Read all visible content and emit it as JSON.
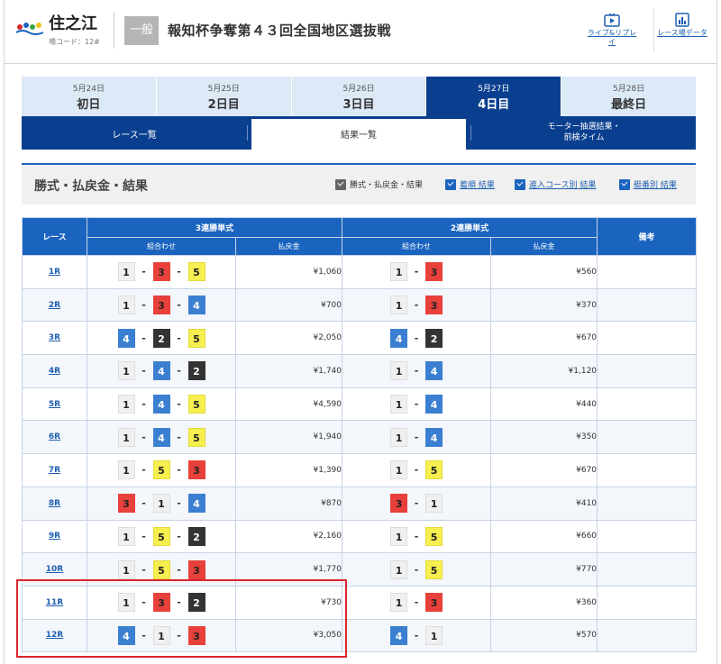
{
  "header": {
    "venue": "住之江",
    "venue_code": "場コード：12#",
    "grade": "一般",
    "race_title": "報知杯争奪第４３回全国地区選抜戦",
    "live_label": "ライブ&リプレイ",
    "data_label": "レース場データ"
  },
  "days": [
    {
      "date": "5月24日",
      "name": "初日",
      "active": false
    },
    {
      "date": "5月25日",
      "name": "2日目",
      "active": false
    },
    {
      "date": "5月26日",
      "name": "3日目",
      "active": false
    },
    {
      "date": "5月27日",
      "name": "4日目",
      "active": true
    },
    {
      "date": "5月28日",
      "name": "最終日",
      "active": false
    }
  ],
  "subtabs": {
    "race_list": "レース一覧",
    "result_list": "結果一覧",
    "motor_line1": "モーター抽選結果・",
    "motor_line2": "前検タイム"
  },
  "section": {
    "title": "勝式・払戻金・結果",
    "filters": [
      {
        "label": "勝式・払戻金・結果",
        "style": "gray",
        "link": false
      },
      {
        "label": "着順 結果",
        "style": "blue",
        "link": true
      },
      {
        "label": "進入コース別 結果",
        "style": "blue",
        "link": true
      },
      {
        "label": "艇番別 結果",
        "style": "blue",
        "link": true
      }
    ]
  },
  "table": {
    "col_race": "レース",
    "col_trifecta": "3連勝単式",
    "col_exacta": "2連勝単式",
    "col_note": "備考",
    "col_combo": "組合わせ",
    "col_payout": "払戻金",
    "rows": [
      {
        "race": "1R",
        "tri": [
          1,
          3,
          5
        ],
        "tri_pay": "¥1,060",
        "ex": [
          1,
          3
        ],
        "ex_pay": "¥560",
        "note": ""
      },
      {
        "race": "2R",
        "tri": [
          1,
          3,
          4
        ],
        "tri_pay": "¥700",
        "ex": [
          1,
          3
        ],
        "ex_pay": "¥370",
        "note": ""
      },
      {
        "race": "3R",
        "tri": [
          4,
          2,
          5
        ],
        "tri_pay": "¥2,050",
        "ex": [
          4,
          2
        ],
        "ex_pay": "¥670",
        "note": ""
      },
      {
        "race": "4R",
        "tri": [
          1,
          4,
          2
        ],
        "tri_pay": "¥1,740",
        "ex": [
          1,
          4
        ],
        "ex_pay": "¥1,120",
        "note": ""
      },
      {
        "race": "5R",
        "tri": [
          1,
          4,
          5
        ],
        "tri_pay": "¥4,590",
        "ex": [
          1,
          4
        ],
        "ex_pay": "¥440",
        "note": ""
      },
      {
        "race": "6R",
        "tri": [
          1,
          4,
          5
        ],
        "tri_pay": "¥1,940",
        "ex": [
          1,
          4
        ],
        "ex_pay": "¥350",
        "note": ""
      },
      {
        "race": "7R",
        "tri": [
          1,
          5,
          3
        ],
        "tri_pay": "¥1,390",
        "ex": [
          1,
          5
        ],
        "ex_pay": "¥670",
        "note": ""
      },
      {
        "race": "8R",
        "tri": [
          3,
          1,
          4
        ],
        "tri_pay": "¥870",
        "ex": [
          3,
          1
        ],
        "ex_pay": "¥410",
        "note": ""
      },
      {
        "race": "9R",
        "tri": [
          1,
          5,
          2
        ],
        "tri_pay": "¥2,160",
        "ex": [
          1,
          5
        ],
        "ex_pay": "¥660",
        "note": ""
      },
      {
        "race": "10R",
        "tri": [
          1,
          5,
          3
        ],
        "tri_pay": "¥1,770",
        "ex": [
          1,
          5
        ],
        "ex_pay": "¥770",
        "note": ""
      },
      {
        "race": "11R",
        "tri": [
          1,
          3,
          2
        ],
        "tri_pay": "¥730",
        "ex": [
          1,
          3
        ],
        "ex_pay": "¥360",
        "note": ""
      },
      {
        "race": "12R",
        "tri": [
          4,
          1,
          3
        ],
        "tri_pay": "¥3,050",
        "ex": [
          4,
          1
        ],
        "ex_pay": "¥570",
        "note": ""
      }
    ]
  },
  "colors": {
    "accent": "#0a3f8f",
    "table_header": "#1a64c0",
    "highlight_box": "#d9262e",
    "boat_1": "#f0f0f0",
    "boat_2": "#333333",
    "boat_3": "#e8403a",
    "boat_4": "#3b7fd1",
    "boat_5": "#f6ef4f",
    "boat_6": "#3aa64a"
  }
}
